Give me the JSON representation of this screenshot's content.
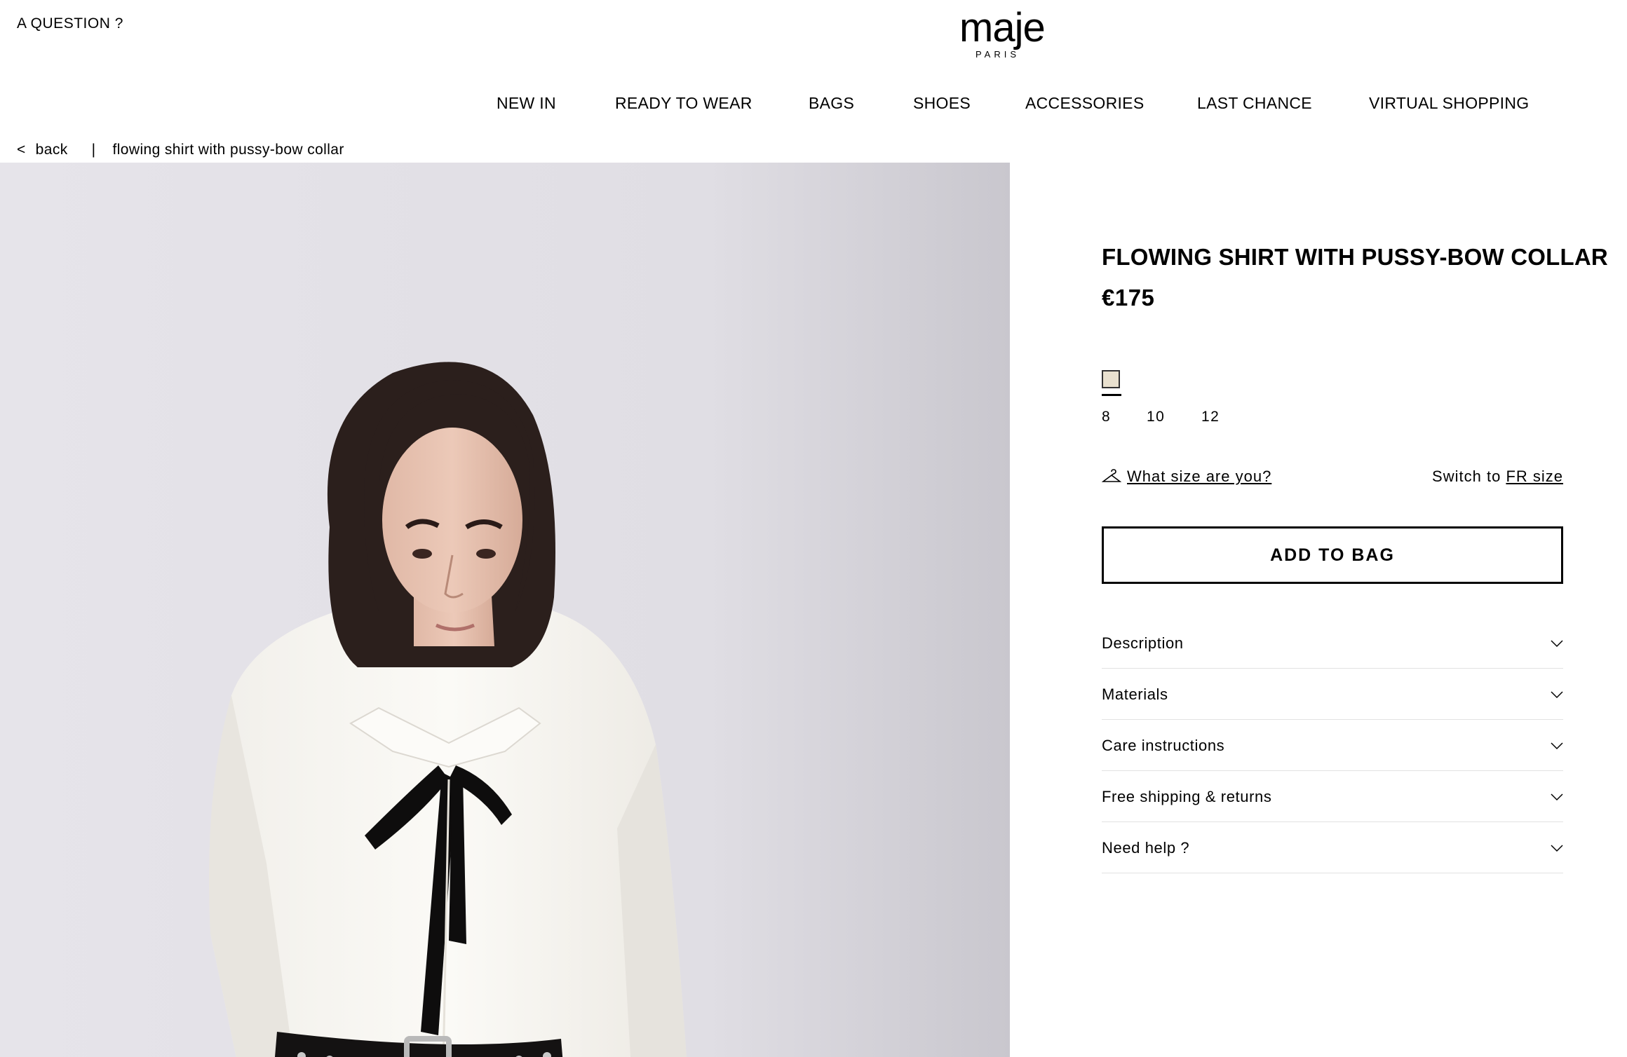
{
  "header": {
    "question_link": "A QUESTION ?",
    "logo": {
      "word": "maje",
      "sub": "PARIS"
    }
  },
  "nav": {
    "items": [
      "NEW IN",
      "READY TO WEAR",
      "BAGS",
      "SHOES",
      "ACCESSORIES",
      "LAST CHANCE",
      "VIRTUAL SHOPPING"
    ]
  },
  "breadcrumb": {
    "chevron": "<",
    "back": "back",
    "separator": "|",
    "current": "flowing shirt with pussy-bow collar"
  },
  "product": {
    "title": "FLOWING SHIRT WITH PUSSY-BOW COLLAR",
    "price": "€175",
    "swatch_color": "#e9e1cf",
    "sizes": [
      "8",
      "10",
      "12"
    ],
    "size_help": "What size are you?",
    "switch_prefix": "Switch to",
    "switch_link": "FR size",
    "add_to_bag": "ADD TO BAG"
  },
  "accordion": {
    "items": [
      "Description",
      "Materials",
      "Care instructions",
      "Free shipping & returns",
      "Need help ?"
    ]
  }
}
